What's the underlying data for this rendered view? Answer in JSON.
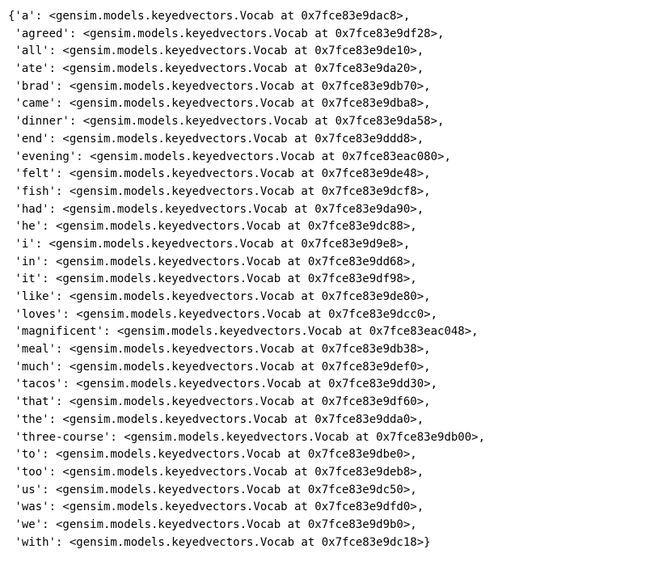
{
  "open_brace": "{",
  "close_brace": "}",
  "class_name": "gensim.models.keyedvectors.Vocab",
  "entries": [
    {
      "key": "a",
      "address": "0x7fce83e9dac8"
    },
    {
      "key": "agreed",
      "address": "0x7fce83e9df28"
    },
    {
      "key": "all",
      "address": "0x7fce83e9de10"
    },
    {
      "key": "ate",
      "address": "0x7fce83e9da20"
    },
    {
      "key": "brad",
      "address": "0x7fce83e9db70"
    },
    {
      "key": "came",
      "address": "0x7fce83e9dba8"
    },
    {
      "key": "dinner",
      "address": "0x7fce83e9da58"
    },
    {
      "key": "end",
      "address": "0x7fce83e9ddd8"
    },
    {
      "key": "evening",
      "address": "0x7fce83eac080"
    },
    {
      "key": "felt",
      "address": "0x7fce83e9de48"
    },
    {
      "key": "fish",
      "address": "0x7fce83e9dcf8"
    },
    {
      "key": "had",
      "address": "0x7fce83e9da90"
    },
    {
      "key": "he",
      "address": "0x7fce83e9dc88"
    },
    {
      "key": "i",
      "address": "0x7fce83e9d9e8"
    },
    {
      "key": "in",
      "address": "0x7fce83e9dd68"
    },
    {
      "key": "it",
      "address": "0x7fce83e9df98"
    },
    {
      "key": "like",
      "address": "0x7fce83e9de80"
    },
    {
      "key": "loves",
      "address": "0x7fce83e9dcc0"
    },
    {
      "key": "magnificent",
      "address": "0x7fce83eac048"
    },
    {
      "key": "meal",
      "address": "0x7fce83e9db38"
    },
    {
      "key": "much",
      "address": "0x7fce83e9def0"
    },
    {
      "key": "tacos",
      "address": "0x7fce83e9dd30"
    },
    {
      "key": "that",
      "address": "0x7fce83e9df60"
    },
    {
      "key": "the",
      "address": "0x7fce83e9dda0"
    },
    {
      "key": "three-course",
      "address": "0x7fce83e9db00"
    },
    {
      "key": "to",
      "address": "0x7fce83e9dbe0"
    },
    {
      "key": "too",
      "address": "0x7fce83e9deb8"
    },
    {
      "key": "us",
      "address": "0x7fce83e9dc50"
    },
    {
      "key": "was",
      "address": "0x7fce83e9dfd0"
    },
    {
      "key": "we",
      "address": "0x7fce83e9d9b0"
    },
    {
      "key": "with",
      "address": "0x7fce83e9dc18"
    }
  ]
}
